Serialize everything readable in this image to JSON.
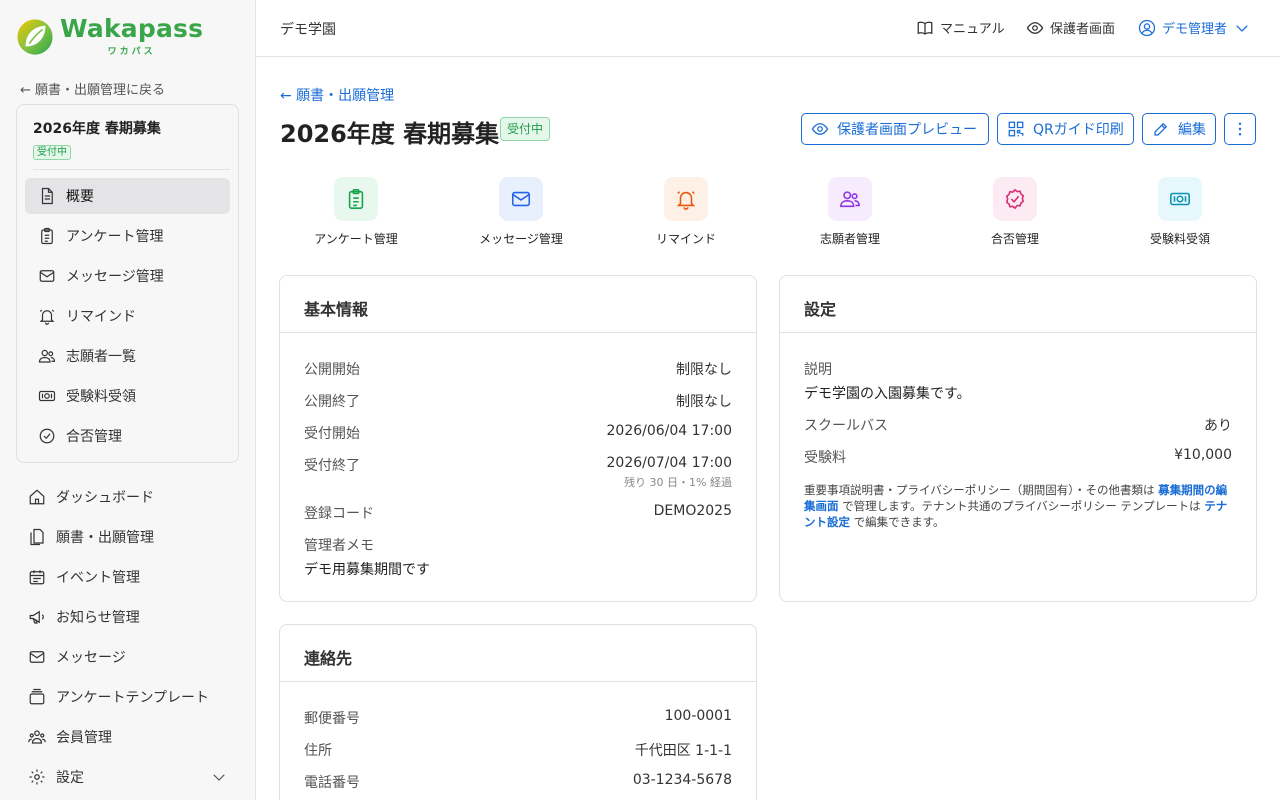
{
  "brand": {
    "name": "Wakapass",
    "kana": "ワカパス"
  },
  "sidebar": {
    "back_link": "← 願書・出願管理に戻る",
    "campaign": {
      "title": "2026年度 春期募集",
      "status": "受付中"
    },
    "sub_nav": [
      {
        "label": "概要",
        "icon": "document-icon"
      },
      {
        "label": "アンケート管理",
        "icon": "clipboard-icon"
      },
      {
        "label": "メッセージ管理",
        "icon": "mail-icon"
      },
      {
        "label": "リマインド",
        "icon": "bell-icon"
      },
      {
        "label": "志願者一覧",
        "icon": "users-icon"
      },
      {
        "label": "受験料受領",
        "icon": "money-icon"
      },
      {
        "label": "合否管理",
        "icon": "check-circle-icon"
      }
    ],
    "nav": [
      {
        "label": "ダッシュボード",
        "icon": "home-icon"
      },
      {
        "label": "願書・出願管理",
        "icon": "files-icon"
      },
      {
        "label": "イベント管理",
        "icon": "calendar-icon"
      },
      {
        "label": "お知らせ管理",
        "icon": "megaphone-icon"
      },
      {
        "label": "メッセージ",
        "icon": "mail-icon"
      },
      {
        "label": "アンケートテンプレート",
        "icon": "template-icon"
      },
      {
        "label": "会員管理",
        "icon": "members-icon"
      },
      {
        "label": "設定",
        "icon": "gear-icon"
      }
    ]
  },
  "header": {
    "school": "デモ学園",
    "manual": "マニュアル",
    "guardian_view": "保護者画面",
    "user": "デモ管理者"
  },
  "main": {
    "breadcrumb": "← 願書・出願管理",
    "title": "2026年度 春期募集",
    "status": "受付中",
    "actions": {
      "preview": "保護者画面プレビュー",
      "qr": "QRガイド印刷",
      "edit": "編集"
    },
    "shortcuts": [
      {
        "label": "アンケート管理",
        "icon": "clipboard-icon",
        "color": "#16a34a",
        "bg": "#e8f8ee"
      },
      {
        "label": "メッセージ管理",
        "icon": "mail-icon",
        "color": "#2563eb",
        "bg": "#e9f0fd"
      },
      {
        "label": "リマインド",
        "icon": "bell-icon",
        "color": "#ea580c",
        "bg": "#fdf0e6"
      },
      {
        "label": "志願者管理",
        "icon": "users-icon",
        "color": "#9333ea",
        "bg": "#f6ecfd"
      },
      {
        "label": "合否管理",
        "icon": "check-badge-icon",
        "color": "#db2777",
        "bg": "#fdebf3"
      },
      {
        "label": "受験料受領",
        "icon": "money-icon",
        "color": "#0891b2",
        "bg": "#e6f8fb"
      }
    ],
    "basic_info": {
      "title": "基本情報",
      "rows": [
        {
          "label": "公開開始",
          "value": "制限なし"
        },
        {
          "label": "公開終了",
          "value": "制限なし"
        },
        {
          "label": "受付開始",
          "value": "2026/06/04 17:00"
        },
        {
          "label": "受付終了",
          "value": "2026/07/04 17:00",
          "sub": "残り 30 日・1% 経過"
        },
        {
          "label": "登録コード",
          "value": "DEMO2025"
        }
      ],
      "memo_label": "管理者メモ",
      "memo_value": "デモ用募集期間です"
    },
    "settings": {
      "title": "設定",
      "description_label": "説明",
      "description_value": "デモ学園の入園募集です。",
      "rows": [
        {
          "label": "スクールバス",
          "value": "あり"
        },
        {
          "label": "受験料",
          "value": "¥10,000"
        }
      ],
      "note_prefix": "重要事項説明書・プライバシーポリシー（期間固有）・その他書類は ",
      "note_link1": "募集期間の編集画面",
      "note_middle": " で管理します。テナント共通のプライバシーポリシー テンプレートは ",
      "note_link2": "テナント設定",
      "note_suffix": " で編集できます。"
    },
    "contact": {
      "title": "連絡先",
      "rows": [
        {
          "label": "郵便番号",
          "value": "100-0001"
        },
        {
          "label": "住所",
          "value": "千代田区 1-1-1"
        },
        {
          "label": "電話番号",
          "value": "03-1234-5678"
        }
      ]
    }
  }
}
